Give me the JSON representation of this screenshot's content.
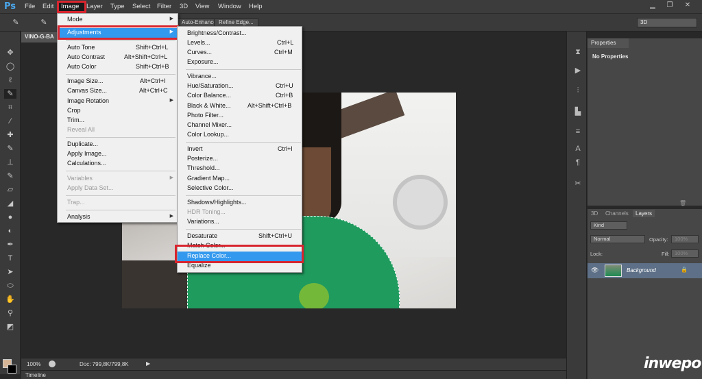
{
  "app": {
    "logo": "Ps"
  },
  "menubar": {
    "items": [
      "File",
      "Edit",
      "Image",
      "Layer",
      "Type",
      "Select",
      "Filter",
      "3D",
      "View",
      "Window",
      "Help"
    ]
  },
  "optionsbar": {
    "enhance_label": "Auto-Enhance",
    "refine_label": "Refine Edge...",
    "workspace": "3D"
  },
  "document": {
    "tab_label": "VINO-G-BA"
  },
  "status": {
    "zoom": "100%",
    "doc_size": "Doc: 799,8K/799,8K"
  },
  "timeline": {
    "label": "Timeline"
  },
  "image_menu": {
    "items": [
      {
        "label": "Mode",
        "shortcut": "",
        "submenu": true
      },
      {
        "label": "Adjustments",
        "shortcut": "",
        "submenu": true,
        "highlighted": true
      },
      {
        "label": "Auto Tone",
        "shortcut": "Shift+Ctrl+L"
      },
      {
        "label": "Auto Contrast",
        "shortcut": "Alt+Shift+Ctrl+L"
      },
      {
        "label": "Auto Color",
        "shortcut": "Shift+Ctrl+B"
      },
      {
        "label": "Image Size...",
        "shortcut": "Alt+Ctrl+I"
      },
      {
        "label": "Canvas Size...",
        "shortcut": "Alt+Ctrl+C"
      },
      {
        "label": "Image Rotation",
        "shortcut": "",
        "submenu": true
      },
      {
        "label": "Crop",
        "shortcut": ""
      },
      {
        "label": "Trim...",
        "shortcut": ""
      },
      {
        "label": "Reveal All",
        "shortcut": "",
        "disabled": true
      },
      {
        "label": "Duplicate...",
        "shortcut": ""
      },
      {
        "label": "Apply Image...",
        "shortcut": ""
      },
      {
        "label": "Calculations...",
        "shortcut": ""
      },
      {
        "label": "Variables",
        "shortcut": "",
        "submenu": true,
        "disabled": true
      },
      {
        "label": "Apply Data Set...",
        "shortcut": "",
        "disabled": true
      },
      {
        "label": "Trap...",
        "shortcut": "",
        "disabled": true
      },
      {
        "label": "Analysis",
        "shortcut": "",
        "submenu": true
      }
    ]
  },
  "adjustments_menu": {
    "items": [
      {
        "label": "Brightness/Contrast...",
        "shortcut": ""
      },
      {
        "label": "Levels...",
        "shortcut": "Ctrl+L"
      },
      {
        "label": "Curves...",
        "shortcut": "Ctrl+M"
      },
      {
        "label": "Exposure...",
        "shortcut": ""
      },
      {
        "label": "Vibrance...",
        "shortcut": ""
      },
      {
        "label": "Hue/Saturation...",
        "shortcut": "Ctrl+U"
      },
      {
        "label": "Color Balance...",
        "shortcut": "Ctrl+B"
      },
      {
        "label": "Black & White...",
        "shortcut": "Alt+Shift+Ctrl+B"
      },
      {
        "label": "Photo Filter...",
        "shortcut": ""
      },
      {
        "label": "Channel Mixer...",
        "shortcut": ""
      },
      {
        "label": "Color Lookup...",
        "shortcut": ""
      },
      {
        "label": "Invert",
        "shortcut": "Ctrl+I"
      },
      {
        "label": "Posterize...",
        "shortcut": ""
      },
      {
        "label": "Threshold...",
        "shortcut": ""
      },
      {
        "label": "Gradient Map...",
        "shortcut": ""
      },
      {
        "label": "Selective Color...",
        "shortcut": ""
      },
      {
        "label": "Shadows/Highlights...",
        "shortcut": ""
      },
      {
        "label": "HDR Toning...",
        "shortcut": "",
        "disabled": true
      },
      {
        "label": "Variations...",
        "shortcut": ""
      },
      {
        "label": "Desaturate",
        "shortcut": "Shift+Ctrl+U"
      },
      {
        "label": "Match Color...",
        "shortcut": ""
      },
      {
        "label": "Replace Color...",
        "shortcut": "",
        "highlighted": true
      },
      {
        "label": "Equalize",
        "shortcut": ""
      }
    ]
  },
  "properties": {
    "tab": "Properties",
    "title": "No Properties"
  },
  "layers": {
    "tabs": [
      "3D",
      "Channels",
      "Layers"
    ],
    "kind": "Kind",
    "blend": "Normal",
    "opacity_label": "Opacity:",
    "opacity": "100%",
    "lock_label": "Lock:",
    "fill_label": "Fill:",
    "fill": "100%",
    "layer_name": "Background"
  },
  "watermark": "inwepo",
  "colors": {
    "foreground": "#d6b596",
    "background": "#000000",
    "highlight": "#3399ee",
    "callout": "#d8252f"
  }
}
